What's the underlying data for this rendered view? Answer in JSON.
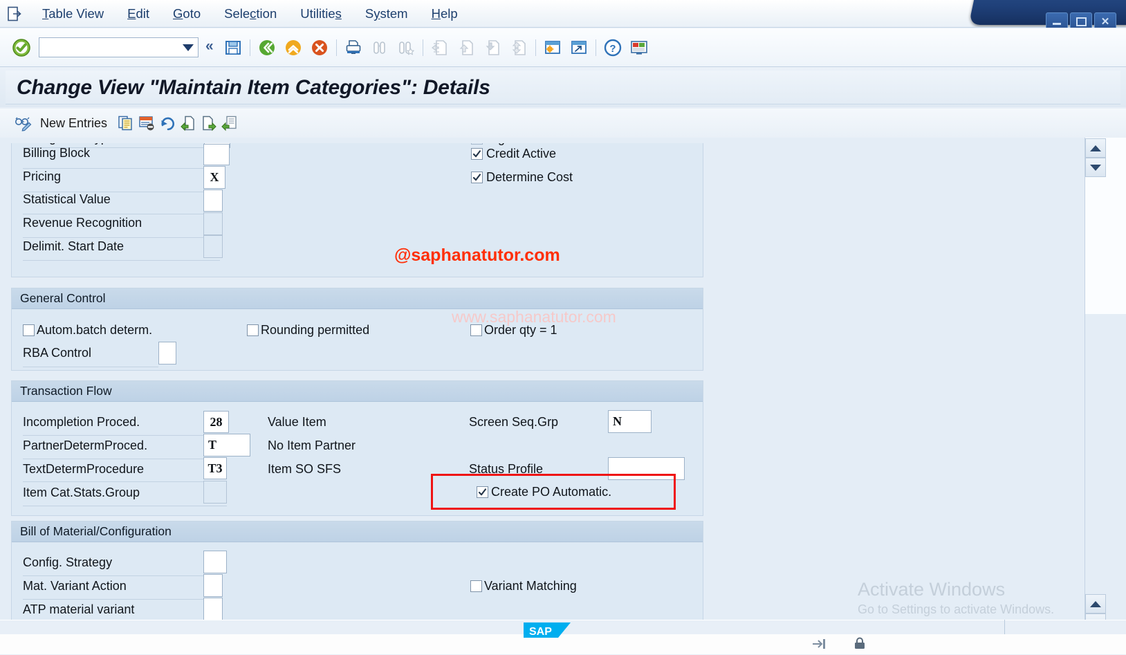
{
  "window": {
    "buttons": [
      {
        "name": "minimize",
        "glyph": "minimize-icon"
      },
      {
        "name": "restore",
        "glyph": "restore-icon"
      },
      {
        "name": "close",
        "glyph": "close-icon"
      }
    ]
  },
  "menubar": {
    "doc_icon": "document-exit-icon",
    "items": [
      {
        "label": "Table View",
        "accesskey": "T"
      },
      {
        "label": "Edit",
        "accesskey": "E"
      },
      {
        "label": "Goto",
        "accesskey": "G"
      },
      {
        "label": "Selection",
        "accesskey": "c"
      },
      {
        "label": "Utilities",
        "accesskey": "s"
      },
      {
        "label": "System",
        "accesskey": "y"
      },
      {
        "label": "Help",
        "accesskey": "H"
      }
    ]
  },
  "toolbar": {
    "ok_icon": "green-check-icon",
    "command_field_value": "",
    "command_field_placeholder": "",
    "dropdown_icon": "chevron-down-icon",
    "collapse_icon": "double-chevron-left-icon",
    "icons": [
      {
        "name": "save-icon",
        "enabled": true
      },
      {
        "name": "back-icon",
        "enabled": true
      },
      {
        "name": "exit-icon",
        "enabled": true
      },
      {
        "name": "cancel-icon",
        "enabled": true
      },
      {
        "name": "print-icon",
        "enabled": true
      },
      {
        "name": "find-icon",
        "enabled": false
      },
      {
        "name": "find-next-icon",
        "enabled": false
      },
      {
        "name": "first-page-icon",
        "enabled": false
      },
      {
        "name": "previous-page-icon",
        "enabled": false
      },
      {
        "name": "next-page-icon",
        "enabled": false
      },
      {
        "name": "last-page-icon",
        "enabled": false
      },
      {
        "name": "create-session-icon",
        "enabled": true
      },
      {
        "name": "create-shortcut-icon",
        "enabled": true
      },
      {
        "name": "help-icon",
        "enabled": true
      },
      {
        "name": "customize-local-layout-icon",
        "enabled": true
      }
    ]
  },
  "page": {
    "title": "Change View \"Maintain Item Categories\": Details"
  },
  "app_toolbar": {
    "glasses_icon": "display-change-icon",
    "new_entries_label": "New Entries",
    "icons": [
      {
        "name": "copy-as-icon"
      },
      {
        "name": "delete-icon"
      },
      {
        "name": "undo-icon"
      },
      {
        "name": "previous-entry-icon"
      },
      {
        "name": "next-entry-icon"
      },
      {
        "name": "variable-list-icon"
      }
    ]
  },
  "form": {
    "top_section": {
      "clipped_label_left": "Billing Plan Type",
      "clipped_label_right": "Wght/Vol.Relevant",
      "left_fields": [
        {
          "label": "Billing Block",
          "value": "",
          "disabled": false
        },
        {
          "label": "Pricing",
          "value": "X",
          "disabled": false
        },
        {
          "label": "Statistical Value",
          "value": "",
          "disabled": false
        },
        {
          "label": "Revenue Recognition",
          "value": "",
          "disabled": true
        },
        {
          "label": "Delimit. Start Date",
          "value": "",
          "disabled": true
        }
      ],
      "right_checkboxes": [
        {
          "label": "Credit Active",
          "checked": true
        },
        {
          "label": "Determine Cost",
          "checked": true
        }
      ]
    },
    "general_control": {
      "title": "General Control",
      "checkboxes": [
        {
          "label": "Autom.batch determ.",
          "checked": false
        },
        {
          "label": "Rounding permitted",
          "checked": false
        },
        {
          "label": "Order qty = 1",
          "checked": false
        }
      ],
      "fields": [
        {
          "label": "RBA Control",
          "value": "",
          "disabled": false
        }
      ]
    },
    "transaction_flow": {
      "title": "Transaction Flow",
      "left_fields": [
        {
          "label": "Incompletion Proced.",
          "value": "28",
          "disabled": false
        },
        {
          "label": "PartnerDetermProced.",
          "value": "T",
          "disabled": false
        },
        {
          "label": "TextDetermProcedure",
          "value": "T3",
          "disabled": false
        },
        {
          "label": "Item Cat.Stats.Group",
          "value": "",
          "disabled": true
        }
      ],
      "descriptions": [
        "Value Item",
        "No Item Partner",
        "Item SO SFS"
      ],
      "right_fields": [
        {
          "label": "Screen Seq.Grp",
          "value": "N",
          "disabled": false
        },
        {
          "label": "Status Profile",
          "value": "",
          "disabled": false
        }
      ],
      "highlighted_checkbox": {
        "label": "Create PO Automatic.",
        "checked": true
      }
    },
    "bill_of_material": {
      "title": "Bill of Material/Configuration",
      "left_fields": [
        {
          "label": "Config. Strategy",
          "value": "",
          "disabled": false
        },
        {
          "label": "Mat. Variant Action",
          "value": "",
          "disabled": false
        },
        {
          "label": "ATP material variant",
          "value": "",
          "disabled": false
        }
      ],
      "checkboxes": [
        {
          "label": "Variant Matching",
          "checked": false
        }
      ]
    }
  },
  "watermarks": {
    "red": "@saphanatutor.com",
    "pink": "www.saphanatutor.com",
    "activate_title": "Activate Windows",
    "activate_subtitle": "Go to Settings to activate Windows."
  },
  "colors": {
    "highlight_red": "#ef1313",
    "watermark_red": "#ff2f08",
    "section_header": "#c9daea",
    "panel_bg": "#dde9f4",
    "content_bg": "#e4edf6"
  },
  "scrollbars": {
    "up_icon": "triangle-up-icon",
    "down_icon": "triangle-down-icon"
  },
  "statusbar": {
    "logo": "sap-logo"
  }
}
